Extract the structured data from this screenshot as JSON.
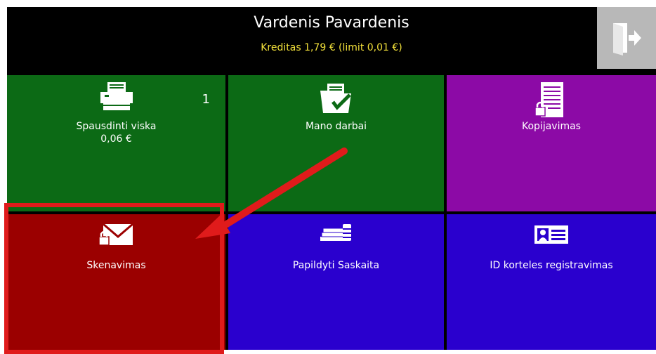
{
  "header": {
    "user_name": "Vardenis Pavardenis",
    "credit_text": "Kreditas 1,79 € (limit 0,01 €)"
  },
  "tiles": [
    {
      "label": "Spausdinti viska",
      "sub": "0,06 €",
      "badge": "1",
      "icon": "printer-icon",
      "color": "#0c6a15"
    },
    {
      "label": "Mano darbai",
      "icon": "folder-check-icon",
      "color": "#0c6a15"
    },
    {
      "label": "Kopijavimas",
      "icon": "locked-document-icon",
      "color": "#8c0aa6"
    },
    {
      "label": "Skenavimas",
      "icon": "locked-envelope-icon",
      "color": "#9b0000"
    },
    {
      "label": "Papildyti Saskaita",
      "icon": "money-stack-icon",
      "color": "#2a00ce"
    },
    {
      "label": "ID korteles registravimas",
      "icon": "id-card-icon",
      "color": "#2a00ce"
    }
  ],
  "colors": {
    "background": "#000000",
    "credit_text": "#f2e03a",
    "logout_button": "#b8b8b8",
    "annotation": "#e01b1b"
  }
}
